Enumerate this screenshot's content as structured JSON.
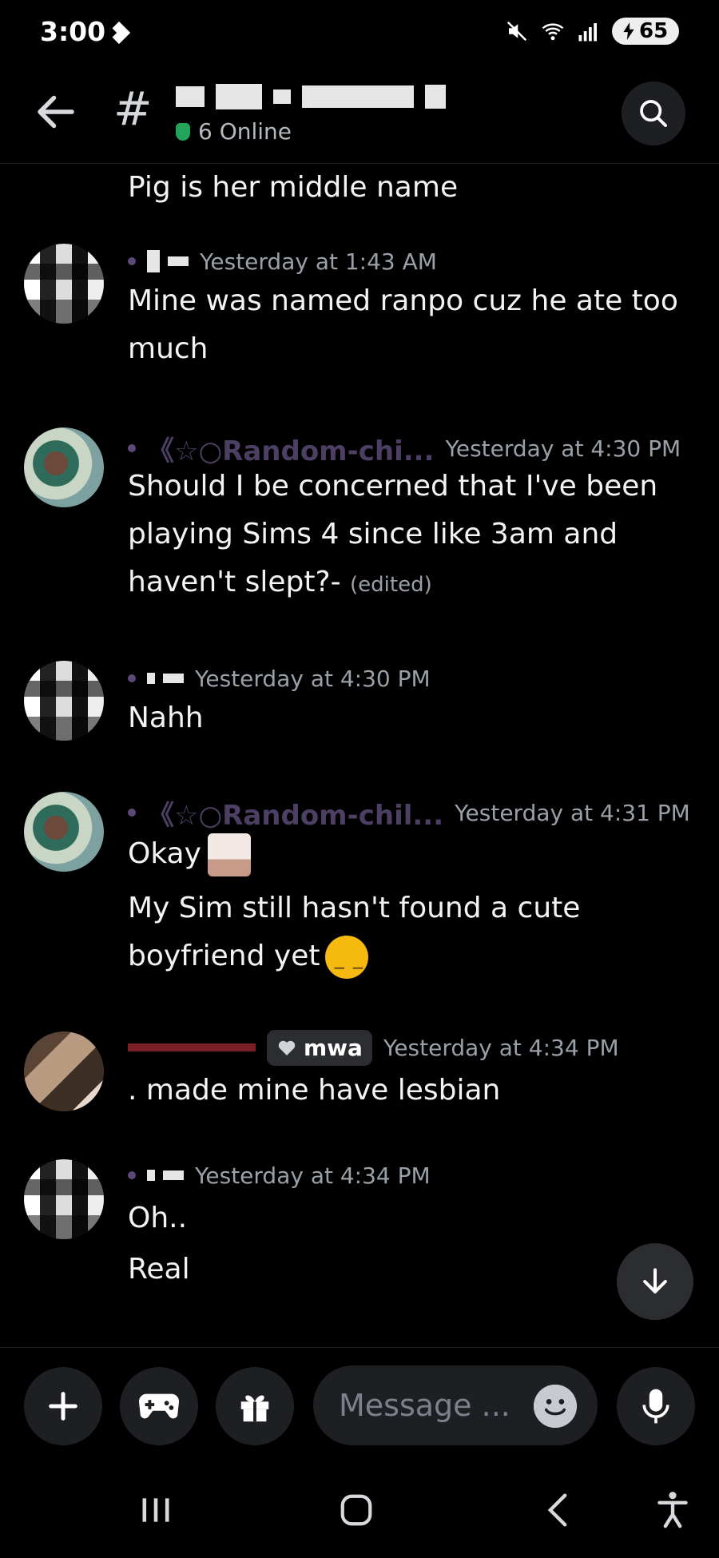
{
  "status_bar": {
    "time": "3:00",
    "battery": "65"
  },
  "header": {
    "online": "6 Online"
  },
  "messages": [
    {
      "text": "Pig is her middle name"
    },
    {
      "timestamp": "Yesterday at 1:43 AM",
      "text": "Mine was named ranpo cuz he ate too much"
    },
    {
      "username": "《☆○Random-chi...",
      "timestamp": "Yesterday at 4:30 PM",
      "text": "Should I be concerned that I've been playing Sims 4 since like 3am and haven't slept?-",
      "edited": "(edited)"
    },
    {
      "timestamp": "Yesterday at 4:30 PM",
      "text": "Nahh"
    },
    {
      "username": "《☆○Random-chil...",
      "timestamp": "Yesterday at 4:31 PM",
      "text1": "Okay",
      "text2": "My Sim still hasn't found a cute boyfriend yet"
    },
    {
      "tag": "mwa",
      "timestamp": "Yesterday at 4:34 PM",
      "text": ". made mine have lesbian"
    },
    {
      "timestamp": "Yesterday at 4:34 PM",
      "text1": "Oh..",
      "text2": "Real"
    }
  ],
  "composer": {
    "placeholder": "Message ..."
  },
  "icons": {
    "back": "back-arrow-icon",
    "search": "search-icon",
    "add": "plus-icon",
    "games": "gamepad-icon",
    "gift": "gift-icon",
    "emoji": "emoji-icon",
    "mic": "microphone-icon",
    "jump": "arrow-down-icon"
  },
  "colors": {
    "background": "#000000",
    "online": "#23a559",
    "role": "#4d3f63"
  }
}
